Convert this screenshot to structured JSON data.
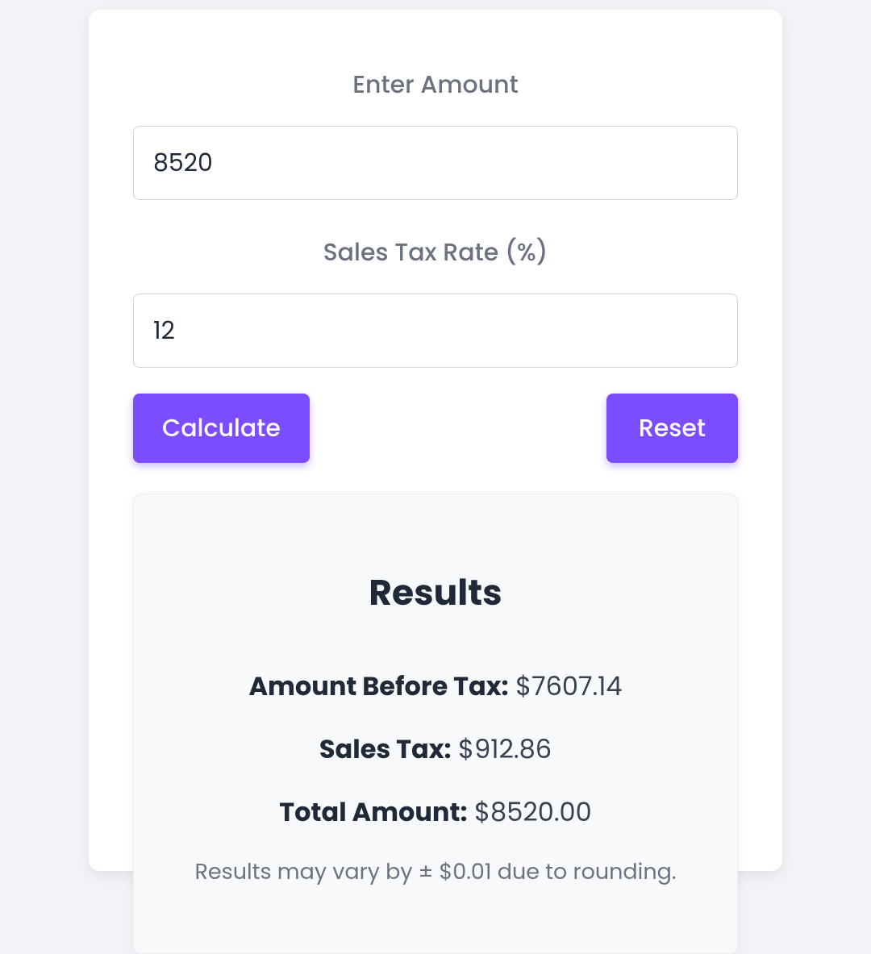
{
  "form": {
    "amount": {
      "label": "Enter Amount",
      "value": "8520"
    },
    "rate": {
      "label": "Sales Tax Rate (%)",
      "value": "12"
    },
    "calculate_label": "Calculate",
    "reset_label": "Reset"
  },
  "results": {
    "title": "Results",
    "amount_before_tax": {
      "label": "Amount Before Tax:",
      "value": "$7607.14"
    },
    "sales_tax": {
      "label": "Sales Tax:",
      "value": "$912.86"
    },
    "total_amount": {
      "label": "Total Amount:",
      "value": "$8520.00"
    },
    "disclaimer": "Results may vary by ± $0.01 due to rounding."
  },
  "colors": {
    "accent": "#7c4dff"
  }
}
